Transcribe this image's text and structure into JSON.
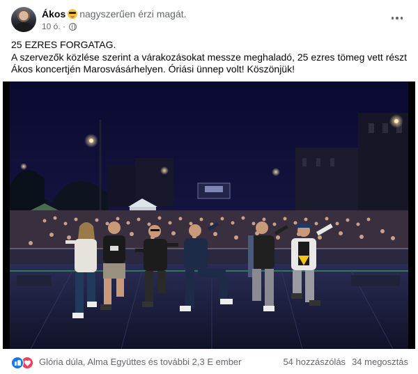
{
  "post": {
    "author": "Ákos",
    "feeling": "nagyszerűen érzi magát.",
    "feeling_emoji": "smiling-face-with-sunglasses",
    "time": "10 ó.",
    "privacy_icon": "globe-icon",
    "text_lines": [
      "25 EZRES FORGATAG.",
      "A szervezők közlése szerint a várakozásokat messze meghaladó, 25 ezres tömeg vett részt",
      "Ákos koncertjén Marosvásárhelyen. Óriási ünnep volt! Köszönjük!"
    ]
  },
  "photo": {
    "description_icons": [
      "concert-crowd",
      "stage",
      "band-members"
    ]
  },
  "footer": {
    "reaction_icons": [
      "like-icon",
      "love-icon"
    ],
    "reactors": "Glória dúla, Alma Együttes és további 2,3 E ember",
    "comments": "54 hozzászólás",
    "shares": "34 megosztás"
  },
  "colors": {
    "accent": "#1877f2",
    "love": "#f33e58",
    "secondary_text": "#65676b",
    "sky": "#0b0a2c",
    "stage_floor": "#16183a"
  }
}
